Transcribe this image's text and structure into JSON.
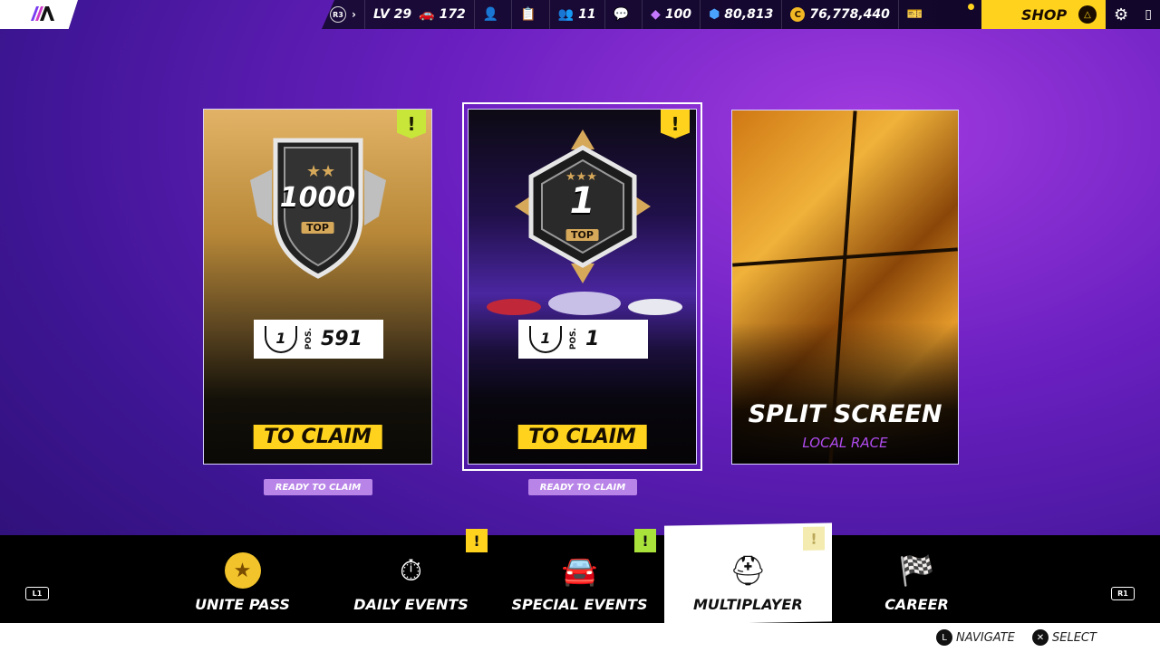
{
  "topbar": {
    "r3_label": "R3",
    "level": "LV 29",
    "cars": "172",
    "friends": "11",
    "gems": "100",
    "tokens": "80,813",
    "coins": "76,778,440",
    "coin_symbol": "C",
    "shop_label": "SHOP",
    "triangle_glyph": "△"
  },
  "cards": [
    {
      "badge_number": "1000",
      "badge_top": "TOP",
      "rank_glyph": "1",
      "pos_label": "POS.",
      "pos_value": "591",
      "claim_label": "TO CLAIM",
      "ready_label": "READY TO CLAIM",
      "alert": "!"
    },
    {
      "badge_number": "1",
      "badge_top": "TOP",
      "rank_glyph": "1",
      "pos_label": "POS.",
      "pos_value": "1",
      "claim_label": "TO CLAIM",
      "ready_label": "READY TO CLAIM",
      "alert": "!"
    },
    {
      "title": "SPLIT SCREEN",
      "subtitle": "LOCAL RACE"
    }
  ],
  "nav": {
    "left_shoulder": "L1",
    "right_shoulder": "R1",
    "items": [
      {
        "label": "UNITE PASS",
        "icon": "star-laurel-icon"
      },
      {
        "label": "DAILY EVENTS",
        "icon": "stopwatch-icon",
        "alert": "!"
      },
      {
        "label": "SPECIAL EVENTS",
        "icon": "car-icon",
        "alert": "!"
      },
      {
        "label": "MULTIPLAYER",
        "icon": "helmets-icon",
        "alert": "!"
      },
      {
        "label": "CAREER",
        "icon": "checkered-flag-icon"
      }
    ]
  },
  "footer": {
    "navigate_btn": "L",
    "navigate_label": "NAVIGATE",
    "select_btn": "✕",
    "select_label": "SELECT"
  },
  "colors": {
    "accent": "#ffd21e",
    "alert_green": "#c8e63a",
    "ready": "#b884e8"
  }
}
